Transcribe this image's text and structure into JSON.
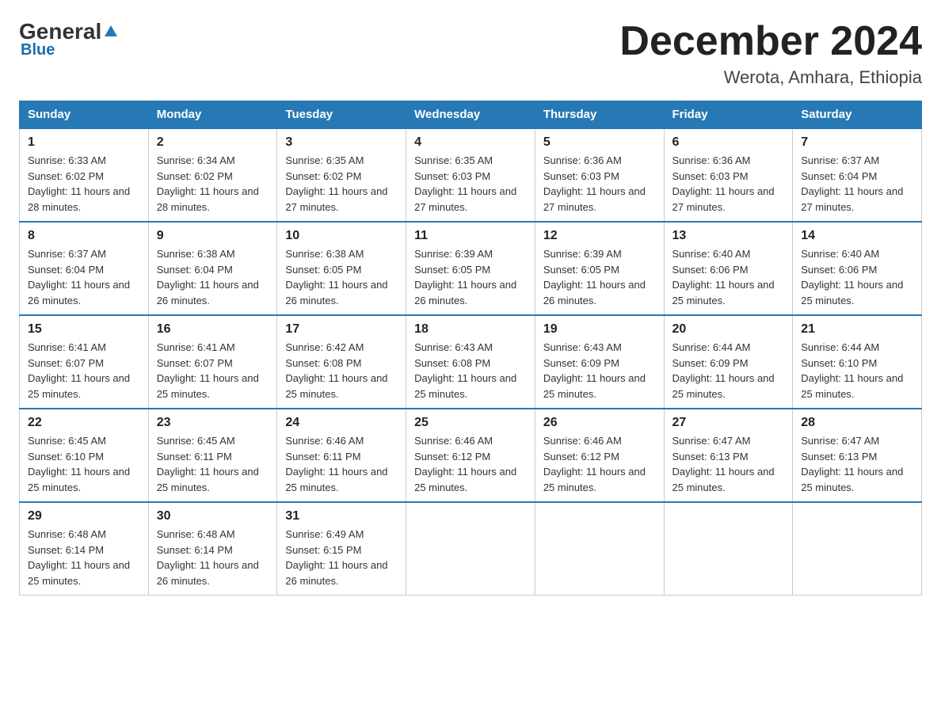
{
  "header": {
    "logo_general": "General",
    "logo_blue": "Blue",
    "subtitle": "Blue",
    "month_title": "December 2024",
    "location": "Werota, Amhara, Ethiopia"
  },
  "weekdays": [
    "Sunday",
    "Monday",
    "Tuesday",
    "Wednesday",
    "Thursday",
    "Friday",
    "Saturday"
  ],
  "weeks": [
    [
      {
        "day": "1",
        "sunrise": "6:33 AM",
        "sunset": "6:02 PM",
        "daylight": "11 hours and 28 minutes."
      },
      {
        "day": "2",
        "sunrise": "6:34 AM",
        "sunset": "6:02 PM",
        "daylight": "11 hours and 28 minutes."
      },
      {
        "day": "3",
        "sunrise": "6:35 AM",
        "sunset": "6:02 PM",
        "daylight": "11 hours and 27 minutes."
      },
      {
        "day": "4",
        "sunrise": "6:35 AM",
        "sunset": "6:03 PM",
        "daylight": "11 hours and 27 minutes."
      },
      {
        "day": "5",
        "sunrise": "6:36 AM",
        "sunset": "6:03 PM",
        "daylight": "11 hours and 27 minutes."
      },
      {
        "day": "6",
        "sunrise": "6:36 AM",
        "sunset": "6:03 PM",
        "daylight": "11 hours and 27 minutes."
      },
      {
        "day": "7",
        "sunrise": "6:37 AM",
        "sunset": "6:04 PM",
        "daylight": "11 hours and 27 minutes."
      }
    ],
    [
      {
        "day": "8",
        "sunrise": "6:37 AM",
        "sunset": "6:04 PM",
        "daylight": "11 hours and 26 minutes."
      },
      {
        "day": "9",
        "sunrise": "6:38 AM",
        "sunset": "6:04 PM",
        "daylight": "11 hours and 26 minutes."
      },
      {
        "day": "10",
        "sunrise": "6:38 AM",
        "sunset": "6:05 PM",
        "daylight": "11 hours and 26 minutes."
      },
      {
        "day": "11",
        "sunrise": "6:39 AM",
        "sunset": "6:05 PM",
        "daylight": "11 hours and 26 minutes."
      },
      {
        "day": "12",
        "sunrise": "6:39 AM",
        "sunset": "6:05 PM",
        "daylight": "11 hours and 26 minutes."
      },
      {
        "day": "13",
        "sunrise": "6:40 AM",
        "sunset": "6:06 PM",
        "daylight": "11 hours and 25 minutes."
      },
      {
        "day": "14",
        "sunrise": "6:40 AM",
        "sunset": "6:06 PM",
        "daylight": "11 hours and 25 minutes."
      }
    ],
    [
      {
        "day": "15",
        "sunrise": "6:41 AM",
        "sunset": "6:07 PM",
        "daylight": "11 hours and 25 minutes."
      },
      {
        "day": "16",
        "sunrise": "6:41 AM",
        "sunset": "6:07 PM",
        "daylight": "11 hours and 25 minutes."
      },
      {
        "day": "17",
        "sunrise": "6:42 AM",
        "sunset": "6:08 PM",
        "daylight": "11 hours and 25 minutes."
      },
      {
        "day": "18",
        "sunrise": "6:43 AM",
        "sunset": "6:08 PM",
        "daylight": "11 hours and 25 minutes."
      },
      {
        "day": "19",
        "sunrise": "6:43 AM",
        "sunset": "6:09 PM",
        "daylight": "11 hours and 25 minutes."
      },
      {
        "day": "20",
        "sunrise": "6:44 AM",
        "sunset": "6:09 PM",
        "daylight": "11 hours and 25 minutes."
      },
      {
        "day": "21",
        "sunrise": "6:44 AM",
        "sunset": "6:10 PM",
        "daylight": "11 hours and 25 minutes."
      }
    ],
    [
      {
        "day": "22",
        "sunrise": "6:45 AM",
        "sunset": "6:10 PM",
        "daylight": "11 hours and 25 minutes."
      },
      {
        "day": "23",
        "sunrise": "6:45 AM",
        "sunset": "6:11 PM",
        "daylight": "11 hours and 25 minutes."
      },
      {
        "day": "24",
        "sunrise": "6:46 AM",
        "sunset": "6:11 PM",
        "daylight": "11 hours and 25 minutes."
      },
      {
        "day": "25",
        "sunrise": "6:46 AM",
        "sunset": "6:12 PM",
        "daylight": "11 hours and 25 minutes."
      },
      {
        "day": "26",
        "sunrise": "6:46 AM",
        "sunset": "6:12 PM",
        "daylight": "11 hours and 25 minutes."
      },
      {
        "day": "27",
        "sunrise": "6:47 AM",
        "sunset": "6:13 PM",
        "daylight": "11 hours and 25 minutes."
      },
      {
        "day": "28",
        "sunrise": "6:47 AM",
        "sunset": "6:13 PM",
        "daylight": "11 hours and 25 minutes."
      }
    ],
    [
      {
        "day": "29",
        "sunrise": "6:48 AM",
        "sunset": "6:14 PM",
        "daylight": "11 hours and 25 minutes."
      },
      {
        "day": "30",
        "sunrise": "6:48 AM",
        "sunset": "6:14 PM",
        "daylight": "11 hours and 26 minutes."
      },
      {
        "day": "31",
        "sunrise": "6:49 AM",
        "sunset": "6:15 PM",
        "daylight": "11 hours and 26 minutes."
      },
      null,
      null,
      null,
      null
    ]
  ]
}
